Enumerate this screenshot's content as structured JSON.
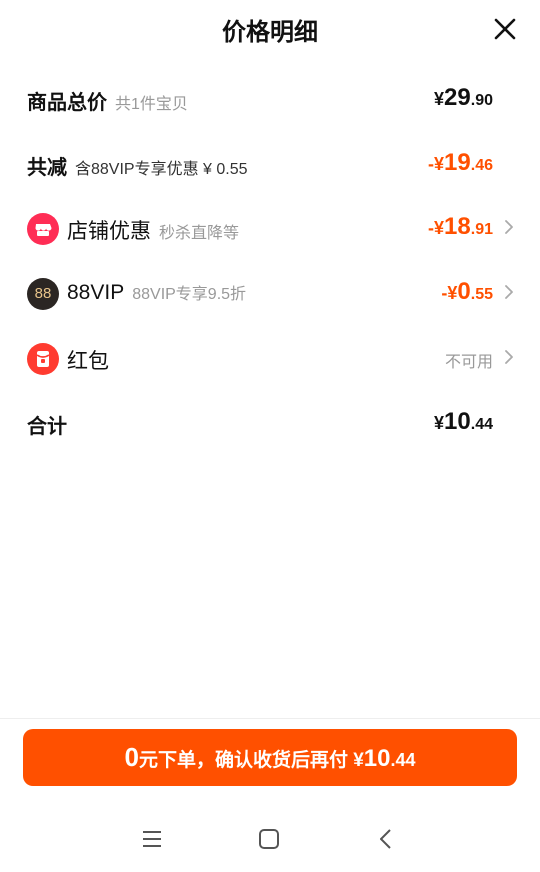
{
  "header": {
    "title": "价格明细"
  },
  "rows": {
    "total": {
      "label": "商品总价",
      "sub": "共1件宝贝",
      "sym": "¥",
      "int": "29",
      "dec": ".90"
    },
    "reduce": {
      "label": "共减",
      "sub": "含88VIP专享优惠 ¥ 0.55",
      "sym": "-¥",
      "int": "19",
      "dec": ".46"
    },
    "shop": {
      "label": "店铺优惠",
      "sub": "秒杀直降等",
      "sym": "-¥",
      "int": "18",
      "dec": ".91",
      "icon": "shop-icon"
    },
    "vip": {
      "label": "88VIP",
      "sub": "88VIP专享9.5折",
      "sym": "-¥",
      "int": "0",
      "dec": ".55",
      "icon": "88vip-icon",
      "icon_text": "88"
    },
    "redpack": {
      "label": "红包",
      "status": "不可用",
      "icon": "red-packet-icon"
    },
    "sum": {
      "label": "合计",
      "sym": "¥",
      "int": "10",
      "dec": ".44"
    }
  },
  "cta": {
    "zero": "0",
    "text": "元下单，确认收货后再付 ",
    "sym": "¥",
    "int": "10",
    "dec": ".44"
  },
  "colors": {
    "accent": "#ff5000",
    "shop_icon_bg": "#ff2d55",
    "vip_icon_bg": "#2b2623"
  }
}
